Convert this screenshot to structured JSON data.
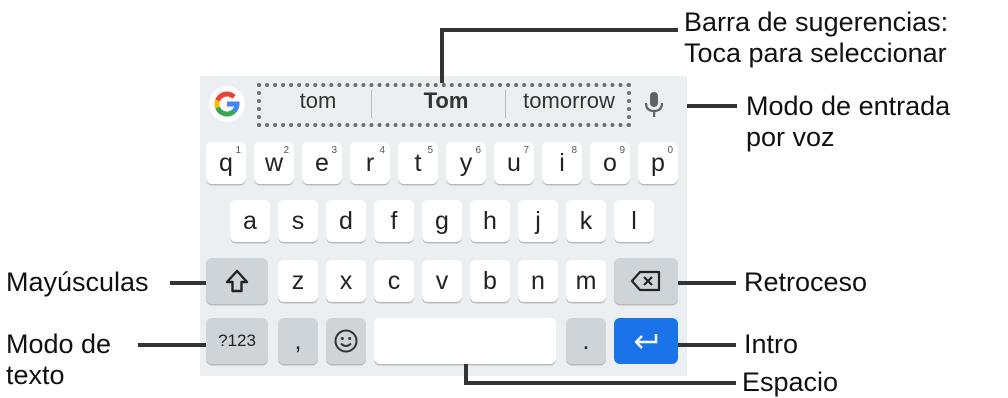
{
  "suggestion_bar": {
    "left": "tom",
    "center": "Tom",
    "right": "tomorrow"
  },
  "rows": {
    "row1": [
      {
        "label": "q",
        "hint": "1"
      },
      {
        "label": "w",
        "hint": "2"
      },
      {
        "label": "e",
        "hint": "3"
      },
      {
        "label": "r",
        "hint": "4"
      },
      {
        "label": "t",
        "hint": "5"
      },
      {
        "label": "y",
        "hint": "6"
      },
      {
        "label": "u",
        "hint": "7"
      },
      {
        "label": "i",
        "hint": "8"
      },
      {
        "label": "o",
        "hint": "9"
      },
      {
        "label": "p",
        "hint": "0"
      }
    ],
    "row2": [
      "a",
      "s",
      "d",
      "f",
      "g",
      "h",
      "j",
      "k",
      "l"
    ],
    "row3": [
      "z",
      "x",
      "c",
      "v",
      "b",
      "n",
      "m"
    ]
  },
  "bottom_row": {
    "symbols_label": "?123",
    "comma_label": ",",
    "period_label": "."
  },
  "icons": {
    "google": "google-g-icon",
    "mic": "microphone-icon",
    "shift": "shift-arrow-icon",
    "backspace": "backspace-icon",
    "emoji": "emoji-smiley-icon",
    "enter": "enter-arrow-icon"
  },
  "callouts": {
    "suggestion_bar_line1": "Barra de sugerencias:",
    "suggestion_bar_line2": "Toca para seleccionar",
    "voice_line1": "Modo de entrada",
    "voice_line2": "por voz",
    "shift": "Mayúsculas",
    "backspace": "Retroceso",
    "text_mode_line1": "Modo de",
    "text_mode_line2": "texto",
    "enter": "Intro",
    "space": "Espacio"
  },
  "colors": {
    "keyboard_bg": "#eceff1",
    "key_bg": "#ffffff",
    "special_key_bg": "#cfd4d8",
    "enter_key_bg": "#1a73e8"
  }
}
